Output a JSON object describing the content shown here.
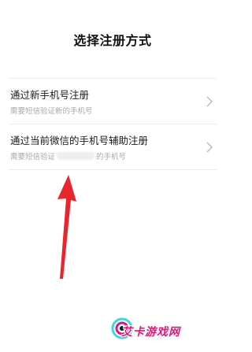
{
  "page": {
    "title": "选择注册方式"
  },
  "options": [
    {
      "label": "通过新手机号注册",
      "subtitle": "需要短信验证新的手机号",
      "chevron_icon": "chevron-right-icon"
    },
    {
      "label": "通过当前微信的手机号辅助注册",
      "subtitle_prefix": "需要短信验证",
      "subtitle_suffix": "的手机号",
      "chevron_icon": "chevron-right-icon"
    }
  ],
  "annotation": {
    "arrow_color": "#e8262c",
    "arrow_icon": "red-arrow-pointing-up"
  },
  "watermark": {
    "text": "艾卡游戏网",
    "color": "#e4157a"
  }
}
